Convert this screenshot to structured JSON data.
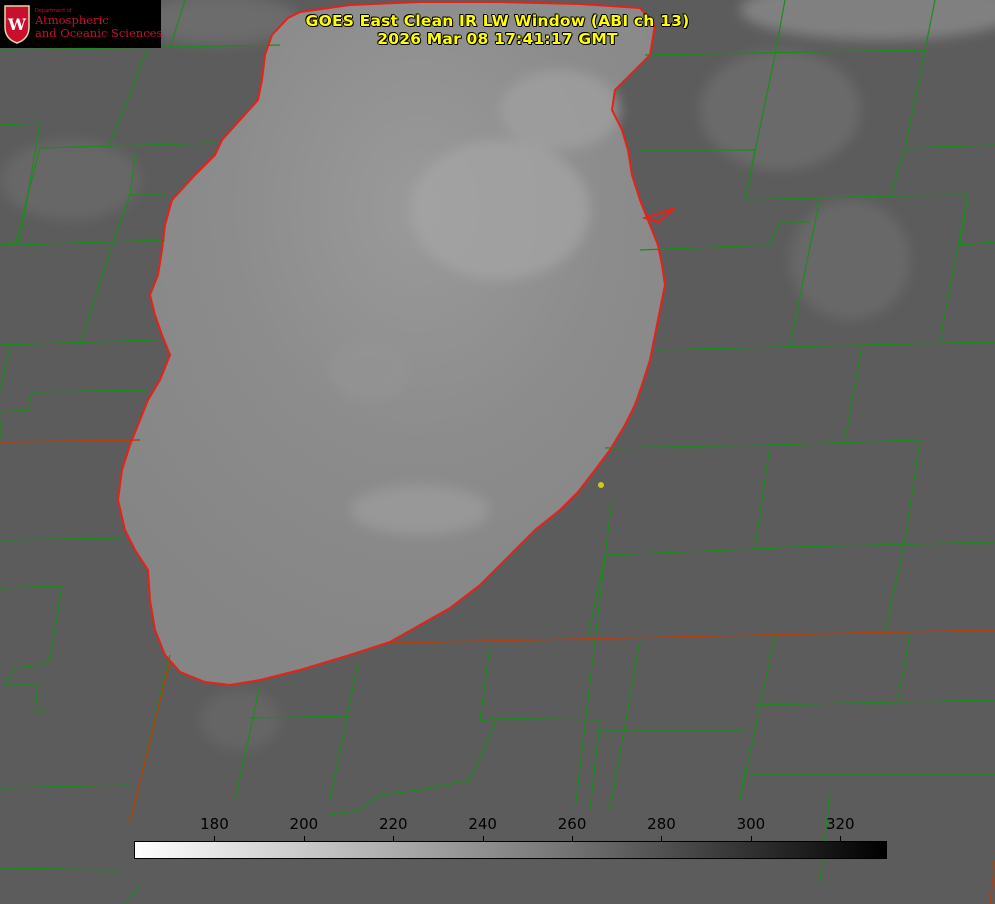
{
  "logo": {
    "dept": "Department of",
    "line1": "Atmospheric",
    "line2": "and Oceanic Sciences",
    "seal_letter": "W"
  },
  "title": {
    "line1": "GOES East Clean IR LW Window (ABI ch 13)",
    "line2": "2026 Mar 08 17:41:17 GMT"
  },
  "colorbar": {
    "ticks": [
      "180",
      "200",
      "220",
      "240",
      "260",
      "280",
      "300",
      "320"
    ],
    "range": [
      162,
      330
    ]
  },
  "colors": {
    "lake_outline": "#e8201a",
    "county_lines": "#1f8a1f",
    "state_lines": "#b04010",
    "title": "#ffff00",
    "marker": "#d4c81a",
    "logo_text": "#c8102e"
  },
  "icons": [
    "uw-seal-icon",
    "location-marker-icon"
  ]
}
